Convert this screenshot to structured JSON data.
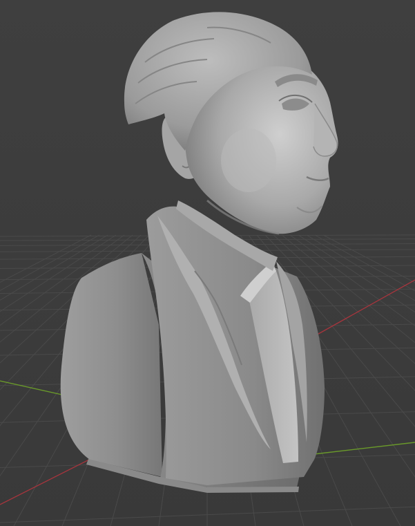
{
  "viewport": {
    "background_color": "#3d3d3d",
    "grid_color": "#4a4a4a",
    "x_axis_color": "#a5353d",
    "y_axis_color": "#6a9a2a"
  },
  "model": {
    "subject": "sculpted bust",
    "material_color": "#9a9a9a",
    "highlight_color": "#c9c9c9",
    "shadow_color": "#6e6e6e"
  }
}
